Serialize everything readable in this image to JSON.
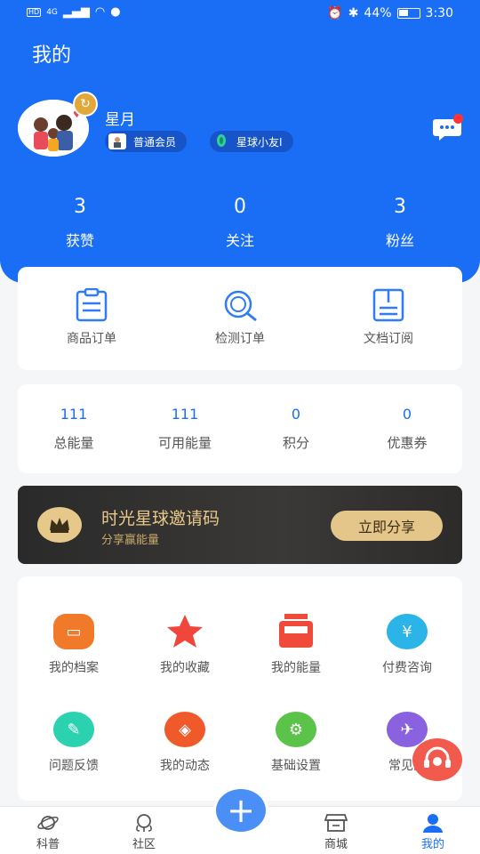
{
  "status_bar": {
    "battery": "44%",
    "time": "3:30",
    "network": "4G"
  },
  "header": {
    "title": "我的"
  },
  "profile": {
    "name": "星月",
    "member_tag": "普通会员",
    "star_tag": "星球小友I"
  },
  "stats": [
    {
      "value": "3",
      "label": "获赞"
    },
    {
      "value": "0",
      "label": "关注"
    },
    {
      "value": "3",
      "label": "粉丝"
    }
  ],
  "orders": [
    {
      "label": "商品订单",
      "icon": "clipboard-icon"
    },
    {
      "label": "检测订单",
      "icon": "search-test-icon"
    },
    {
      "label": "文档订阅",
      "icon": "document-icon"
    }
  ],
  "energy": [
    {
      "value": "111",
      "label": "总能量"
    },
    {
      "value": "111",
      "label": "可用能量"
    },
    {
      "value": "0",
      "label": "积分"
    },
    {
      "value": "0",
      "label": "优惠券"
    }
  ],
  "invite": {
    "title": "时光星球邀请码",
    "subtitle": "分享赢能量",
    "button": "立即分享"
  },
  "tools": [
    {
      "label": "我的档案",
      "icon": "archive-icon",
      "color": "#f07a2a"
    },
    {
      "label": "我的收藏",
      "icon": "star-icon",
      "color": "#f0463b"
    },
    {
      "label": "我的能量",
      "icon": "energy-icon",
      "color": "#f04a3a"
    },
    {
      "label": "付费咨询",
      "icon": "yuan-icon",
      "color": "#2ab4e8"
    },
    {
      "label": "问题反馈",
      "icon": "feedback-icon",
      "color": "#2ad2b0"
    },
    {
      "label": "我的动态",
      "icon": "compass-icon",
      "color": "#f05a2a"
    },
    {
      "label": "基础设置",
      "icon": "gear-icon",
      "color": "#5cc34a"
    },
    {
      "label": "常见问",
      "icon": "faq-icon",
      "color": "#8a62e0"
    }
  ],
  "tabs": [
    {
      "label": "科普",
      "icon": "planet-icon"
    },
    {
      "label": "社区",
      "icon": "community-icon"
    },
    {
      "label": "商城",
      "icon": "store-icon"
    },
    {
      "label": "我的",
      "icon": "user-icon"
    }
  ]
}
